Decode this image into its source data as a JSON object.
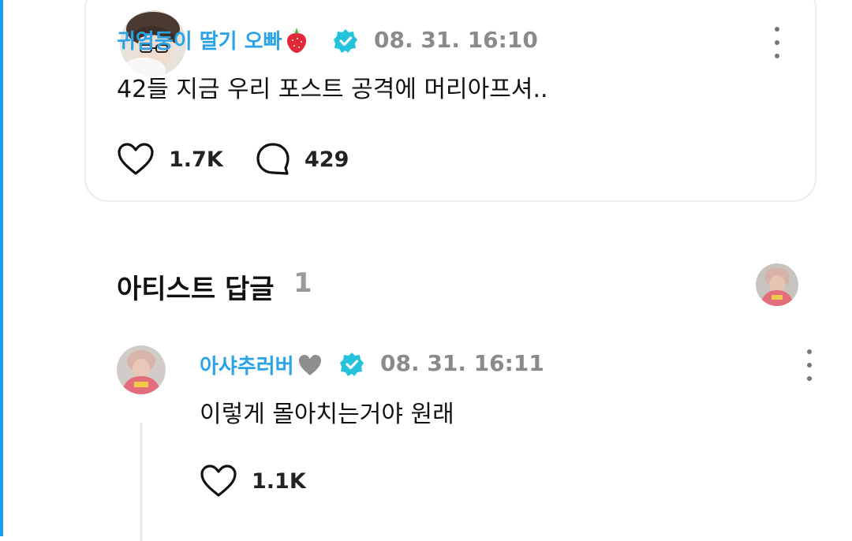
{
  "post": {
    "author": "귀염둥이 딸기 오빠",
    "author_emoji": "strawberry-emoji",
    "timestamp": "08. 31. 16:10",
    "text": "42들 지금 우리 포스트 공격에 머리아프셔..",
    "likes": "1.7K",
    "comments": "429"
  },
  "artist_section": {
    "title": "아티스트 답글",
    "count": "1"
  },
  "reply": {
    "author": "아샤추러버",
    "author_emoji": "grey-heart-emoji",
    "timestamp": "08. 31. 16:11",
    "text": "이렇게 몰아치는거야 원래",
    "likes": "1.1K"
  },
  "colors": {
    "name": "#2aa3e6",
    "verified": "#25c2dc",
    "timestamp": "#8a8a8a",
    "accent_edge": "#1d9bf0"
  },
  "icons": [
    "heart-icon",
    "comment-bubble-icon",
    "verified-badge-icon",
    "more-options-icon"
  ]
}
